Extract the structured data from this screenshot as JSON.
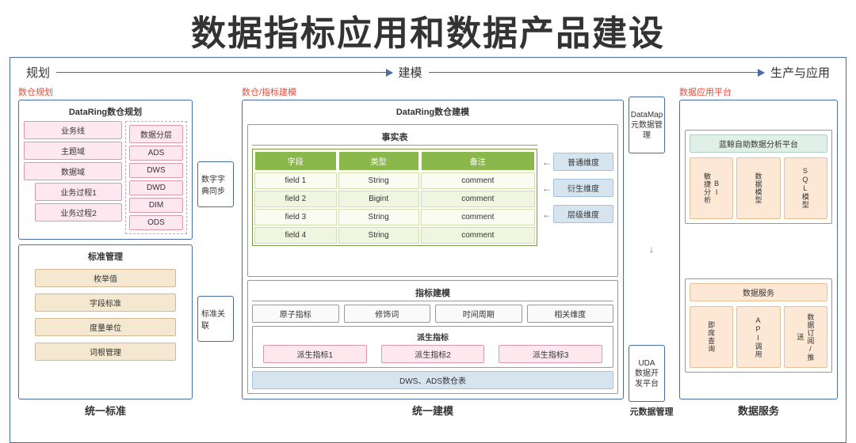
{
  "title": "数据指标应用和数据产品建设",
  "stages": {
    "plan": "规划",
    "model": "建模",
    "prod": "生产与应用"
  },
  "left": {
    "red": "数仓规划",
    "dw": {
      "title": "DataRing数仓规划",
      "biz_line": "业务线",
      "topic": "主题域",
      "data_domain": "数据域",
      "proc1": "业务过程1",
      "proc2": "业务过程2",
      "layering": "数据分层",
      "layers": [
        "ADS",
        "DWS",
        "DWD",
        "DIM",
        "ODS"
      ]
    },
    "std": {
      "title": "标准管理",
      "enum": "枚举值",
      "field": "字段标准",
      "unit": "度量单位",
      "root": "词根管理"
    },
    "bottom": "统一标准"
  },
  "bridges": {
    "dict": "数字字典同步",
    "link": "标准关联"
  },
  "center": {
    "red": "数仓/指标建模",
    "dw_model": {
      "title": "DataRing数仓建模",
      "fact": "事实表",
      "headers": {
        "field": "字段",
        "type": "类型",
        "remark": "备注"
      },
      "rows": [
        {
          "f": "field 1",
          "t": "String",
          "r": "comment"
        },
        {
          "f": "field 2",
          "t": "Bigint",
          "r": "comment"
        },
        {
          "f": "field 3",
          "t": "String",
          "r": "comment"
        },
        {
          "f": "field 4",
          "t": "String",
          "r": "comment"
        }
      ],
      "dims": {
        "normal": "普通维度",
        "derived": "衍生维度",
        "level": "层级维度"
      }
    },
    "metric": {
      "title": "指标建模",
      "atom": "原子指标",
      "mod": "修饰词",
      "period": "时间周期",
      "rel": "相关维度",
      "deriv_title": "派生指标",
      "d1": "派生指标1",
      "d2": "派生指标2",
      "d3": "派生指标3",
      "dws": "DWS、ADS数仓表"
    },
    "bottom": "统一建模"
  },
  "right_bridges": {
    "datamap": "DataMap\n元数据管理",
    "uda": "UDA\n数据开发平台",
    "bottom": "元数据管理"
  },
  "right": {
    "red": "数据应用平台",
    "analysis": {
      "title": "蓝鲸自助数据分析平台",
      "bi": "BI\n敏捷分析",
      "dm": "数据模型",
      "sql": "SQL模型"
    },
    "service": {
      "title": "数据服务",
      "query": "即席查询",
      "api": "API调用",
      "sub": "数据订阅/推送"
    },
    "bottom": "数据服务"
  }
}
